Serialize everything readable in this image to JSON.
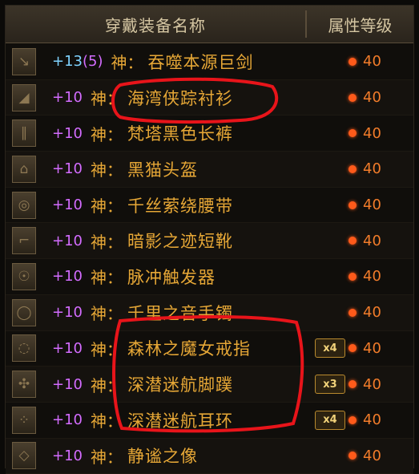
{
  "header": {
    "name_col": "穿戴装备名称",
    "level_col": "属性等级"
  },
  "colors": {
    "name": "#e6a736",
    "plus": "#d36cff",
    "plus_weapon": "#7fd3ff",
    "level": "#f27c2a",
    "mark": "#e8141a"
  },
  "items": [
    {
      "plus": "+13",
      "bonus": "(5)",
      "prefix": "神：",
      "name": "吞噬本源巨剑",
      "level": "40",
      "badge": "",
      "icon": "sword-icon"
    },
    {
      "plus": "+10",
      "bonus": "",
      "prefix": "神：",
      "name": "海湾侠踪衬衫",
      "level": "40",
      "badge": "",
      "icon": "shirt-icon"
    },
    {
      "plus": "+10",
      "bonus": "",
      "prefix": "神：",
      "name": "梵塔黑色长裤",
      "level": "40",
      "badge": "",
      "icon": "pants-icon"
    },
    {
      "plus": "+10",
      "bonus": "",
      "prefix": "神：",
      "name": "黑猫头盔",
      "level": "40",
      "badge": "",
      "icon": "helmet-icon"
    },
    {
      "plus": "+10",
      "bonus": "",
      "prefix": "神：",
      "name": "千丝萦绕腰带",
      "level": "40",
      "badge": "",
      "icon": "belt-icon"
    },
    {
      "plus": "+10",
      "bonus": "",
      "prefix": "神：",
      "name": "暗影之迹短靴",
      "level": "40",
      "badge": "",
      "icon": "boots-icon"
    },
    {
      "plus": "+10",
      "bonus": "",
      "prefix": "神：",
      "name": "脉冲触发器",
      "level": "40",
      "badge": "",
      "icon": "trigger-icon"
    },
    {
      "plus": "+10",
      "bonus": "",
      "prefix": "神：",
      "name": "千里之音手镯",
      "level": "40",
      "badge": "",
      "icon": "bracelet-icon"
    },
    {
      "plus": "+10",
      "bonus": "",
      "prefix": "神：",
      "name": "森林之魔女戒指",
      "level": "40",
      "badge": "x4",
      "icon": "ring-icon"
    },
    {
      "plus": "+10",
      "bonus": "",
      "prefix": "神：",
      "name": "深潜迷航脚蹼",
      "level": "40",
      "badge": "x3",
      "icon": "flipper-icon"
    },
    {
      "plus": "+10",
      "bonus": "",
      "prefix": "神：",
      "name": "深潜迷航耳环",
      "level": "40",
      "badge": "x4",
      "icon": "earring-icon"
    },
    {
      "plus": "+10",
      "bonus": "",
      "prefix": "神：",
      "name": "静谧之像",
      "level": "40",
      "badge": "",
      "icon": "gem-icon"
    }
  ]
}
